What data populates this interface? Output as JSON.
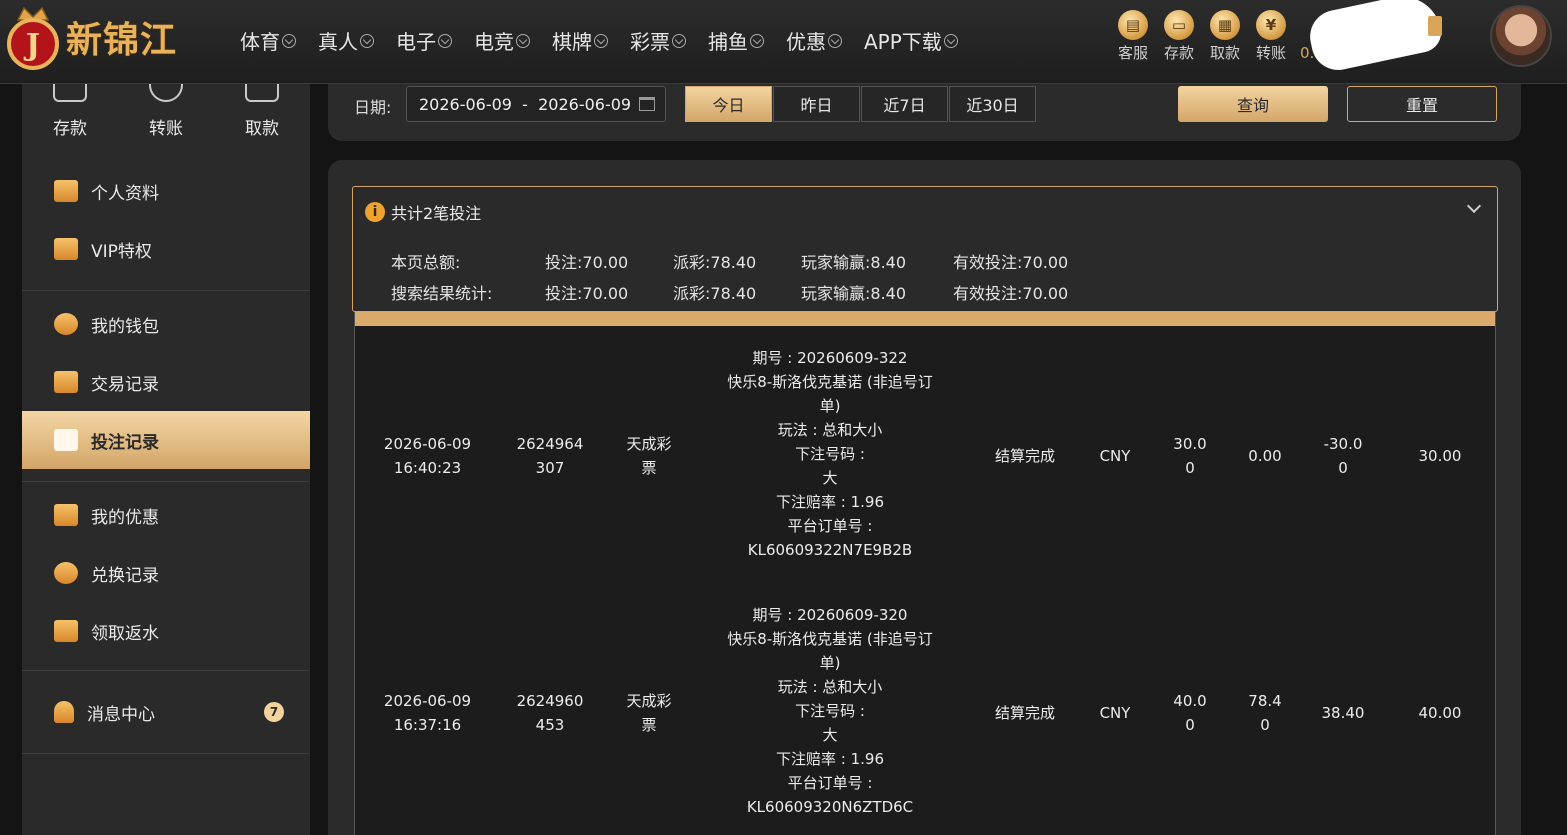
{
  "brand": {
    "name": "新锦江",
    "badge_letter": "J"
  },
  "nav": [
    {
      "label": "体育"
    },
    {
      "label": "真人"
    },
    {
      "label": "电子"
    },
    {
      "label": "电竞"
    },
    {
      "label": "棋牌"
    },
    {
      "label": "彩票"
    },
    {
      "label": "捕鱼"
    },
    {
      "label": "优惠"
    },
    {
      "label": "APP下载"
    }
  ],
  "quick_links": [
    {
      "label": "客服",
      "icon": "chat-icon"
    },
    {
      "label": "存款",
      "icon": "wallet-icon"
    },
    {
      "label": "取款",
      "icon": "atm-icon"
    },
    {
      "label": "转账",
      "icon": "transfer-icon"
    }
  ],
  "balance": {
    "text": "0."
  },
  "sidebar": {
    "top_actions": [
      {
        "label": "存款"
      },
      {
        "label": "转账"
      },
      {
        "label": "取款"
      }
    ],
    "group1": [
      {
        "label": "个人资料"
      },
      {
        "label": "VIP特权"
      }
    ],
    "group2": [
      {
        "label": "我的钱包"
      },
      {
        "label": "交易记录"
      },
      {
        "label": "投注记录"
      }
    ],
    "group3": [
      {
        "label": "我的优惠"
      },
      {
        "label": "兑换记录"
      },
      {
        "label": "领取返水"
      }
    ],
    "group4": [
      {
        "label": "消息中心",
        "badge": "7"
      }
    ],
    "active": "投注记录"
  },
  "filter": {
    "date_label": "日期:",
    "date_range": "2026-06-09  -  2026-06-09",
    "ranges": [
      {
        "label": "今日"
      },
      {
        "label": "昨日"
      },
      {
        "label": "近7日"
      },
      {
        "label": "近30日"
      }
    ],
    "active_range": "今日",
    "query_label": "查询",
    "reset_label": "重置"
  },
  "summary": {
    "title": "共计2笔投注",
    "rows": [
      {
        "label": "本页总额:",
        "bet": "投注:70.00",
        "payout": "派彩:78.40",
        "player_win": "玩家输赢:8.40",
        "valid": "有效投注:70.00"
      },
      {
        "label": "搜索结果统计:",
        "bet": "投注:70.00",
        "payout": "派彩:78.40",
        "player_win": "玩家输赢:8.40",
        "valid": "有效投注:70.00"
      }
    ]
  },
  "bets": [
    {
      "date": "2026-06-09",
      "time": "16:40:23",
      "no_a": "2624964",
      "no_b": "307",
      "game_a": "天成彩",
      "game_b": "票",
      "issue": "期号 : 20260609-322",
      "lottery_a": "快乐8-斯洛伐克基诺 (非追号订",
      "lottery_b": "单)",
      "play": "玩法 : 总和大小",
      "pick_label": "下注号码 :",
      "pick": "大",
      "odds": "下注赔率 : 1.96",
      "order_label": "平台订单号 :",
      "order": "KL60609322N7E9B2B",
      "status": "结算完成",
      "currency": "CNY",
      "bet_a": "30.0",
      "bet_b": "0",
      "payout_a": "0.00",
      "payout_b": "",
      "win_a": "-30.0",
      "win_b": "0",
      "valid": "30.00"
    },
    {
      "date": "2026-06-09",
      "time": "16:37:16",
      "no_a": "2624960",
      "no_b": "453",
      "game_a": "天成彩",
      "game_b": "票",
      "issue": "期号 : 20260609-320",
      "lottery_a": "快乐8-斯洛伐克基诺 (非追号订",
      "lottery_b": "单)",
      "play": "玩法 : 总和大小",
      "pick_label": "下注号码 :",
      "pick": "大",
      "odds": "下注赔率 : 1.96",
      "order_label": "平台订单号 :",
      "order": "KL60609320N6ZTD6C",
      "status": "结算完成",
      "currency": "CNY",
      "bet_a": "40.0",
      "bet_b": "0",
      "payout_a": "78.4",
      "payout_b": "0",
      "win_a": "38.40",
      "win_b": "",
      "valid": "40.00"
    }
  ],
  "colors": {
    "accent": "#d4a66a",
    "accent_light": "#f2d4a0",
    "panel": "#2b2b2b",
    "icon_orange": "#f0a22e"
  }
}
